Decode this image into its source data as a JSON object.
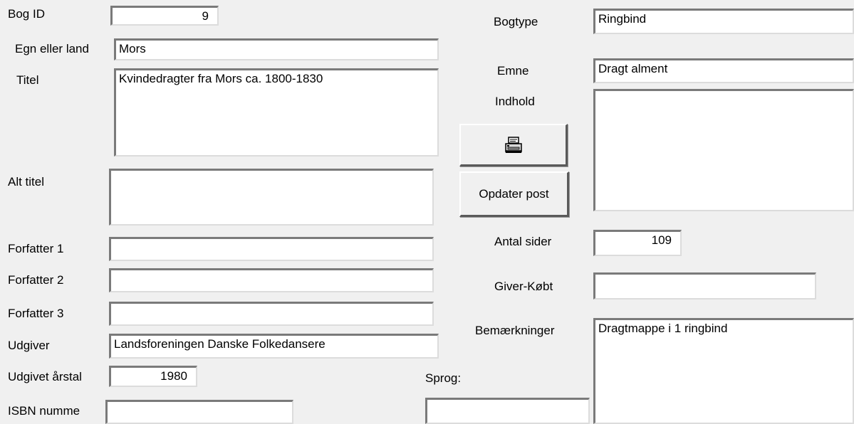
{
  "labels": {
    "bog_id": "Bog ID",
    "egn": "Egn eller land",
    "titel": "Titel",
    "alt_titel": "Alt titel",
    "forfatter1": "Forfatter 1",
    "forfatter2": "Forfatter 2",
    "forfatter3": "Forfatter 3",
    "udgiver": "Udgiver",
    "udgivet_aarstal": "Udgivet årstal",
    "isbn": "ISBN numme",
    "bogtype": "Bogtype",
    "emne": "Emne",
    "indhold": "Indhold",
    "antal_sider": "Antal sider",
    "giver_koebt": "Giver-Købt",
    "bemaerkninger": "Bemærkninger",
    "sprog": "Sprog:"
  },
  "fields": {
    "bog_id": "9",
    "egn": "Mors",
    "titel": "Kvindedragter fra Mors ca. 1800-1830",
    "alt_titel": "",
    "forfatter1": "",
    "forfatter2": "",
    "forfatter3": "",
    "udgiver": "Landsforeningen Danske Folkedansere",
    "udgivet_aarstal": "1980",
    "isbn": "",
    "bogtype": "Ringbind",
    "emne": "Dragt alment",
    "indhold": "",
    "antal_sider": "109",
    "giver_koebt": "",
    "bemaerkninger": "Dragtmappe i 1 ringbind",
    "sprog": ""
  },
  "buttons": {
    "print_icon": "printer-icon",
    "opdater_label": "Opdater post"
  }
}
